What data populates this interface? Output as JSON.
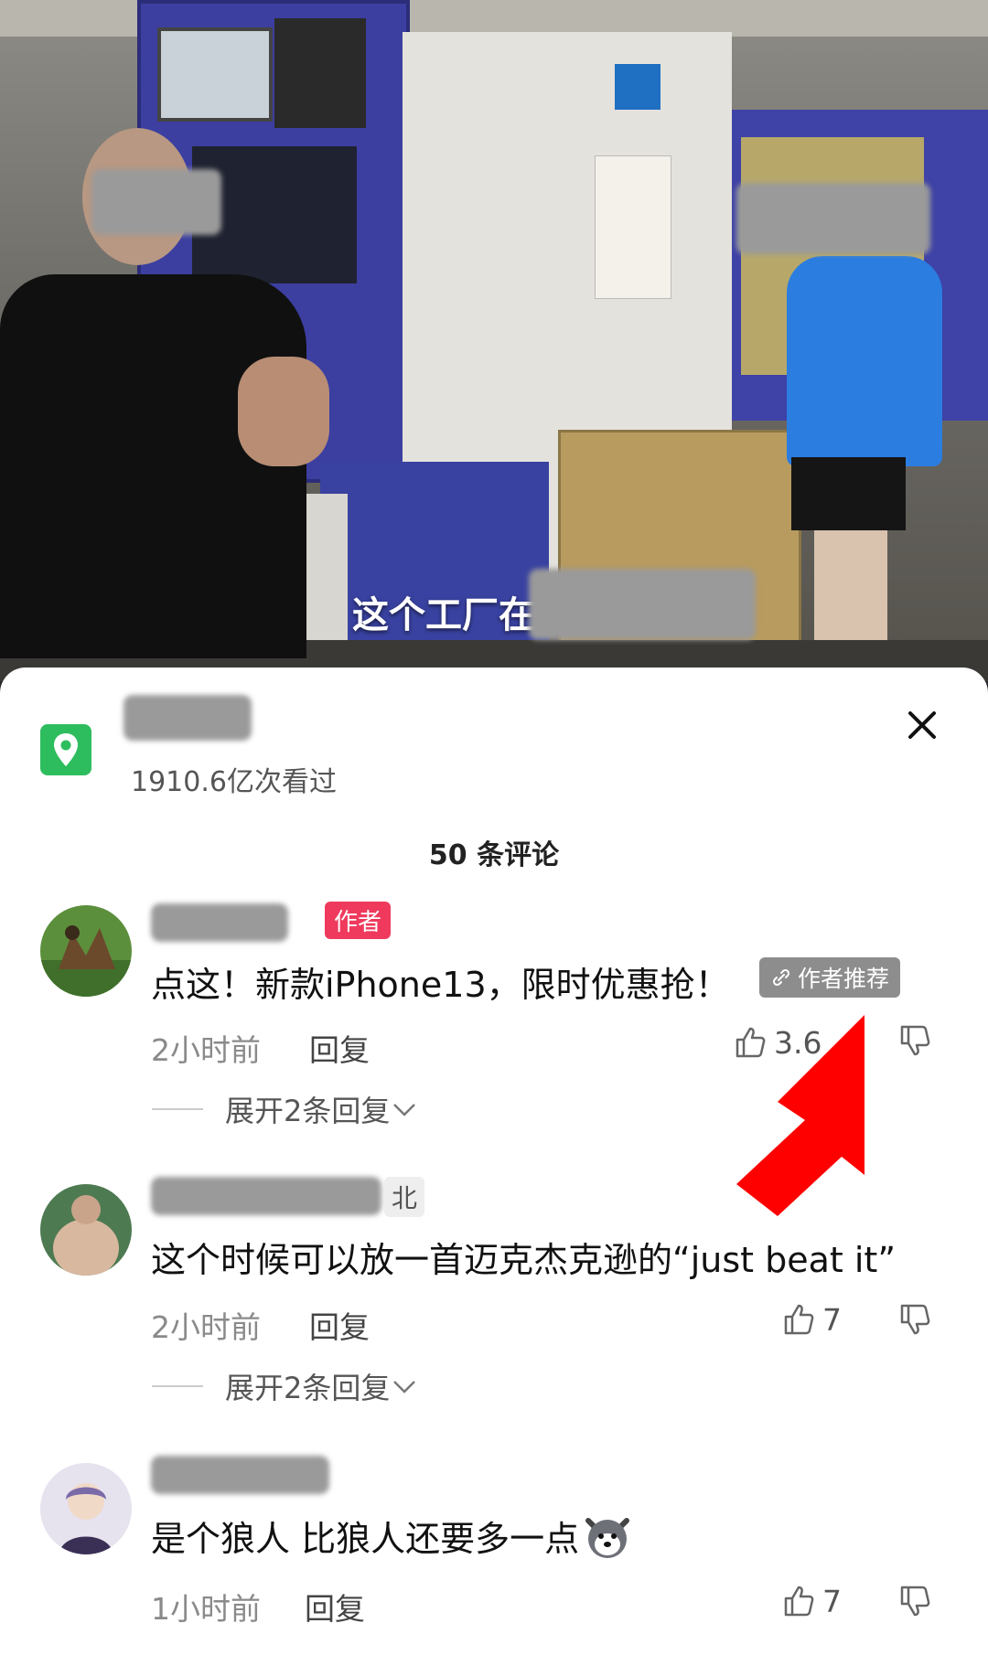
{
  "video": {
    "subtitle": "这个工厂在"
  },
  "location": {
    "icon": "location-pin-icon",
    "views": "1910.6亿次看过"
  },
  "comments_header": {
    "count_label": "50 条评论"
  },
  "comments": [
    {
      "author_badge": "作者",
      "text": "点这！新款iPhone13，限时优惠抢！",
      "recommend_badge": "作者推荐",
      "time": "2小时前",
      "reply": "回复",
      "likes": "3.6",
      "expand": "展开2条回复"
    },
    {
      "name_suffix": "北",
      "text": "这个时候可以放一首迈克杰克逊的“just beat it”",
      "time": "2小时前",
      "reply": "回复",
      "likes": "7",
      "expand": "展开2条回复"
    },
    {
      "text": "是个狼人  比狼人还要多一点",
      "time": "1小时前",
      "reply": "回复",
      "likes": "7"
    }
  ],
  "colors": {
    "location_green": "#2ebd5e",
    "author_red": "#ef3a5d",
    "arrow_red": "#ff0000"
  }
}
